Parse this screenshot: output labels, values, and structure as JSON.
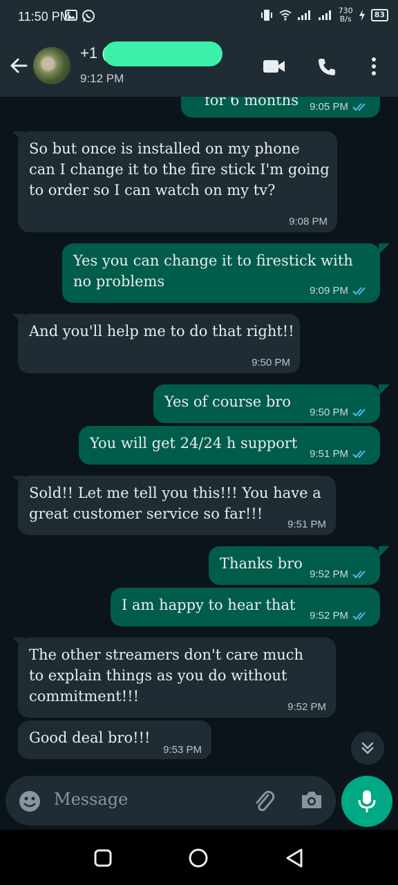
{
  "status_bar": {
    "time": "11:50 PM",
    "net_speed_top": "730",
    "net_speed_bottom": "B/s",
    "battery": "83"
  },
  "header": {
    "contact_name": "+1 (82",
    "last_seen": "9:12 PM"
  },
  "messages": [
    {
      "text": "for 6 months",
      "time": "9:05 PM"
    },
    {
      "text": "So but once is installed on my phone\ncan I change it to the fire stick I'm going\nto order so I can watch on my tv?",
      "time": "9:08 PM"
    },
    {
      "text": "Yes you can change it to firestick with\nno problems",
      "time": "9:09 PM"
    },
    {
      "text": "And you'll help me to do that right!!",
      "time": "9:50 PM"
    },
    {
      "text": "Yes of course bro",
      "time": "9:50 PM"
    },
    {
      "text": "You will get 24/24 h support",
      "time": "9:51 PM"
    },
    {
      "text": "Sold!! Let me tell you this!!! You have a\ngreat customer service so far!!!",
      "time": "9:51 PM"
    },
    {
      "text": "Thanks bro",
      "time": "9:52 PM"
    },
    {
      "text": "I am happy to hear that",
      "time": "9:52 PM"
    },
    {
      "text": "The other streamers don't care much\nto explain things as you do without\ncommitment!!!",
      "time": "9:52 PM"
    },
    {
      "text": "Good deal bro!!!",
      "time": "9:53 PM"
    }
  ],
  "composer": {
    "placeholder": "Message"
  },
  "colors": {
    "outgoing": "#005c4b",
    "incoming": "#1f2c34",
    "read_ticks": "#53bdeb",
    "accent": "#00a884",
    "background": "#0b141a"
  }
}
